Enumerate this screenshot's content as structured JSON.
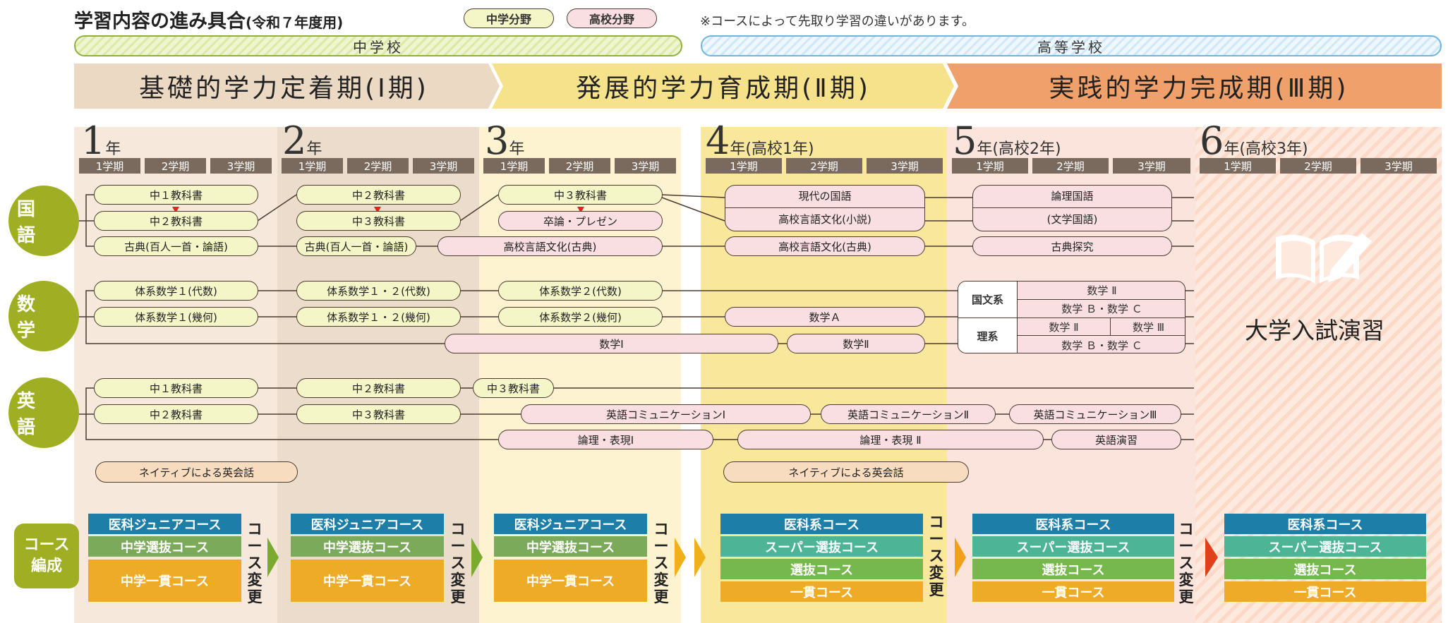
{
  "header": {
    "title": "学習内容の進み具合",
    "title_sub": "(令和７年度用)",
    "legend_jh": "中学分野",
    "legend_hs": "高校分野",
    "note": "※コースによって先取り学習の違いがあります。"
  },
  "schools": {
    "jh": "中学校",
    "hs": "高等学校"
  },
  "phases": [
    {
      "label": "基礎的学力定着期(Ⅰ期)"
    },
    {
      "label": "発展的学力育成期(Ⅱ期)"
    },
    {
      "label": "実践的学力完成期(Ⅲ期)"
    }
  ],
  "years": [
    {
      "num": "1",
      "label": "年"
    },
    {
      "num": "2",
      "label": "年"
    },
    {
      "num": "3",
      "label": "年"
    },
    {
      "num": "4",
      "label": "年(高校1年)"
    },
    {
      "num": "5",
      "label": "年(高校2年)"
    },
    {
      "num": "6",
      "label": "年(高校3年)"
    }
  ],
  "terms": [
    "1学期",
    "2学期",
    "3学期"
  ],
  "subjects": {
    "japanese": "国 語",
    "math": "数 学",
    "english": "英 語",
    "course": "コース\n編成"
  },
  "japanese": {
    "y1a": "中１教科書",
    "y1b": "中２教科書",
    "y1c": "古典(百人一首・論語)",
    "y2a": "中２教科書",
    "y2b": "中３教科書",
    "y2c": "古典(百人一首・論語)",
    "y3a": "中３教科書",
    "y3b": "卒論・プレゼン",
    "hs_kobun": "高校言語文化(古典)",
    "y4a": "現代の国語",
    "y4b": "高校言語文化(小説)",
    "y4c": "高校言語文化(古典)",
    "y5a": "論理国語",
    "y5b": "(文学国語)",
    "y5c": "古典探究"
  },
  "math": {
    "y1a": "体系数学１(代数)",
    "y1b": "体系数学１(幾何)",
    "y2a": "体系数学１・２(代数)",
    "y2b": "体系数学１・２(幾何)",
    "y3a": "体系数学２(代数)",
    "y3b": "体系数学２(幾何)",
    "m1": "数学Ⅰ",
    "mA": "数学Ａ",
    "m2": "数学Ⅱ",
    "bunkei": "国文系",
    "rikei": "理系",
    "b1": "数学 Ⅱ",
    "b2": "数学 Ｂ・数学 Ｃ",
    "r1": "数学 Ⅱ",
    "r2": "数学 Ⅲ",
    "r3": "数学 Ｂ・数学 Ｃ"
  },
  "english": {
    "y1a": "中１教科書",
    "y1b": "中２教科書",
    "y2a": "中２教科書",
    "y2b": "中３教科書",
    "y3a": "中３教科書",
    "ec1": "英語コミュニケーションⅠ",
    "ec2": "英語コミュニケーションⅡ",
    "ec3": "英語コミュニケーションⅢ",
    "lx1": "論理・表現Ⅰ",
    "lx2": "論理・表現 Ⅱ",
    "ee": "英語演習",
    "native1": "ネイティブによる英会話",
    "native2": "ネイティブによる英会話"
  },
  "exam": "大学入試演習",
  "courses": {
    "jh": [
      "医科ジュニアコース",
      "中学選抜コース",
      "中学一貫コース"
    ],
    "hs": [
      "医科系コース",
      "スーパー選抜コース",
      "選抜コース",
      "一貫コース"
    ],
    "change": "コース変更"
  }
}
